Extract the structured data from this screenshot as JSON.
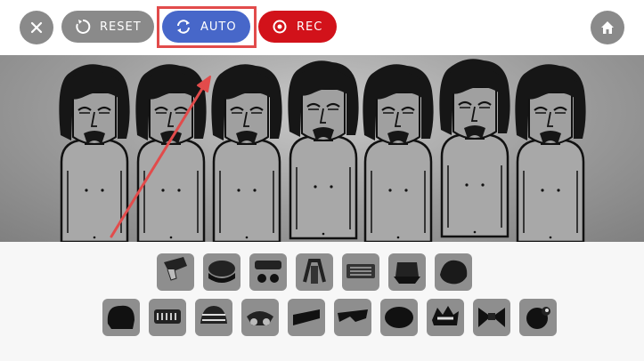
{
  "toolbar": {
    "close_icon": "close-icon",
    "reset_label": "RESET",
    "auto_label": "AUTO",
    "rec_label": "REC",
    "home_icon": "home-icon"
  },
  "colors": {
    "reset_bg": "#8a8a8a",
    "auto_bg": "#4767c9",
    "rec_bg": "#d2121a",
    "highlight": "#e24b4b",
    "tile_bg": "#8e8e8e"
  },
  "characters": [
    {
      "name": "character-1"
    },
    {
      "name": "character-2"
    },
    {
      "name": "character-3"
    },
    {
      "name": "character-4"
    },
    {
      "name": "character-5"
    },
    {
      "name": "character-6"
    },
    {
      "name": "character-7"
    }
  ],
  "sound_icons": {
    "row1": [
      "scarf-icon",
      "cap-icon",
      "glasses-icon",
      "headphones-icon",
      "mouth-grill-icon",
      "hat-icon",
      "hair-icon"
    ],
    "row2": [
      "afro-icon",
      "teeth-icon",
      "striped-cap-icon",
      "goggles-icon",
      "visor-icon",
      "shades-icon",
      "helmet-icon",
      "spiky-hair-icon",
      "bow-icon",
      "creature-icon"
    ]
  }
}
